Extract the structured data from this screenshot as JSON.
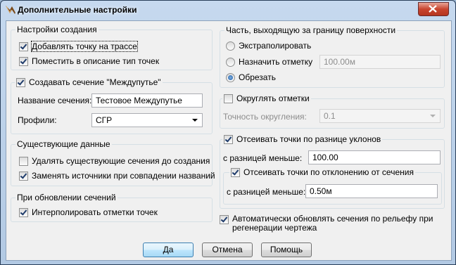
{
  "window": {
    "title": "Дополнительные настройки"
  },
  "creation": {
    "group_title": "Настройки создания",
    "add_point_label": "Добавлять точку на трассе",
    "add_point_checked": true,
    "put_desc_label": "Поместить в описание тип точек",
    "put_desc_checked": true
  },
  "section": {
    "group_title": "Создавать сечение \"Междупутье\"",
    "checked": true,
    "name_label": "Название сечения:",
    "name_value": "Тестовое Междупутье",
    "profiles_label": "Профили:",
    "profiles_value": "СГР"
  },
  "existing": {
    "group_title": "Существующие данные",
    "delete_label": "Удалять существующие сечения до создания",
    "delete_checked": false,
    "replace_label": "Заменять источники при совпадении названий",
    "replace_checked": true
  },
  "update": {
    "group_title": "При обновлении сечений",
    "interp_label": "Интерполировать отметки точек",
    "interp_checked": true
  },
  "outside": {
    "group_title": "Часть, выходящую за границу поверхности",
    "extrapolate_label": "Экстраполировать",
    "assign_label": "Назначить отметку",
    "assign_value": "100.00м",
    "cut_label": "Обрезать",
    "selected": "cut"
  },
  "rounding": {
    "group_title": "Округлять отметки",
    "checked": false,
    "precision_label": "Точность округления:",
    "precision_value": "0.1"
  },
  "slope": {
    "group_title": "Отсеивать точки по разнице уклонов",
    "checked": true,
    "diff_label": "с разницей меньше:",
    "diff_value": "100.00",
    "deviation_title": "Отсеивать точки по отклонению от сечения",
    "deviation_checked": true,
    "dev_diff_label": "с разницей меньше:",
    "dev_diff_value": "0.50м"
  },
  "auto_update": {
    "label_line1": "Автоматически обновлять сечения по рельефу при",
    "label_line2": "регенерации чертежа",
    "checked": true
  },
  "buttons": {
    "ok": "Да",
    "cancel": "Отмена",
    "help": "Помощь"
  }
}
